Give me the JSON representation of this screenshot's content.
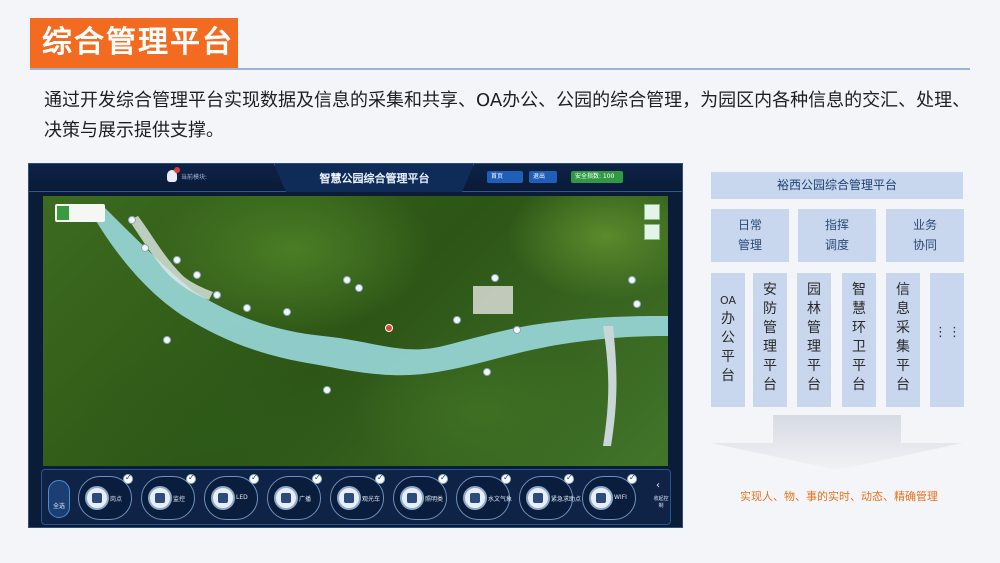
{
  "title": "综合管理平台",
  "intro": "通过开发综合管理平台实现数据及信息的采集和共享、OA办公、公园的综合管理，为园区内各种信息的交汇、处理、决策与展示提供支撑。",
  "screen": {
    "title": "智慧公园综合管理平台",
    "module_label": "当前模块:",
    "home_button": "首页",
    "exit_button": "退出",
    "safe_button": "安全指数: 100",
    "all_label": "全选",
    "collapse_label": "收起控制",
    "tools": [
      "岗点",
      "监控",
      "LED",
      "广播",
      "观光车",
      "照明类",
      "水文气象",
      "紧急求助点",
      "WIFI"
    ]
  },
  "diagram": {
    "header": "裕西公园综合管理平台",
    "categories": [
      [
        "日常",
        "管理"
      ],
      [
        "指挥",
        "调度"
      ],
      [
        "业务",
        "协同"
      ]
    ],
    "platforms": [
      [
        "OA",
        "办",
        "公",
        "平",
        "台"
      ],
      [
        "安",
        "防",
        "管",
        "理",
        "平",
        "台"
      ],
      [
        "园",
        "林",
        "管",
        "理",
        "平",
        "台"
      ],
      [
        "智",
        "慧",
        "环",
        "卫",
        "平",
        "台"
      ],
      [
        "信",
        "息",
        "采",
        "集",
        "平",
        "台"
      ]
    ],
    "more_dots": [
      "⋮",
      "⋮"
    ],
    "footer": "实现人、物、事的实时、动态、精确管理"
  },
  "colors": {
    "title_bg": "#f26b21",
    "diagram_box": "#c8d7ee",
    "footer_text": "#e6731f"
  }
}
